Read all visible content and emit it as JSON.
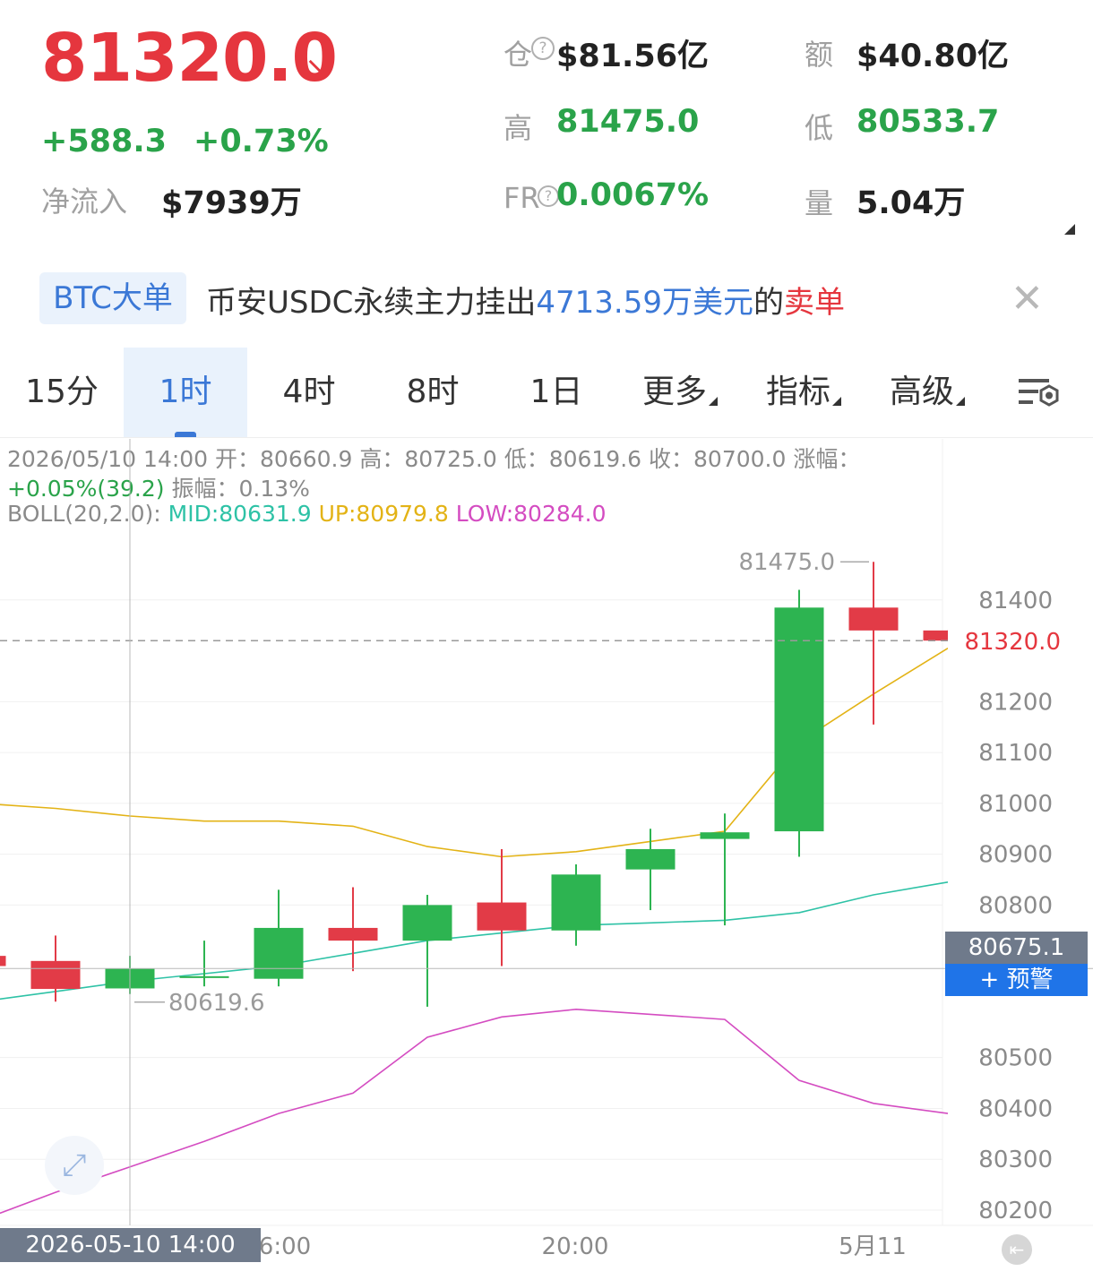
{
  "header": {
    "price": "81320.0",
    "arrow": "↘",
    "change": "+588.3",
    "change_pct": "+0.73%",
    "netflow_label": "净流入",
    "netflow_value": "$7939万",
    "open_interest_label": "仓",
    "open_interest_value": "$81.56亿",
    "volume_amount_label": "额",
    "volume_amount_value": "$40.80亿",
    "high_label": "高",
    "high_value": "81475.0",
    "low_label": "低",
    "low_value": "80533.7",
    "fr_label": "FR",
    "fr_value": "0.0067%",
    "vol_label": "量",
    "vol_value": "5.04万"
  },
  "banner": {
    "tag": "BTC大单",
    "text_prefix": "币安USDC永续主力挂出",
    "amount": "4713.59万美元",
    "text_mid": "的",
    "side": "卖单"
  },
  "tabs": [
    {
      "label": "15分"
    },
    {
      "label": "1时"
    },
    {
      "label": "4时"
    },
    {
      "label": "8时"
    },
    {
      "label": "1日"
    },
    {
      "label": "更多"
    },
    {
      "label": "指标"
    },
    {
      "label": "高级"
    }
  ],
  "info": {
    "line1": "2026/05/10 14:00 开：80660.9 高：80725.0 低：80619.6 收：80700.0 涨幅：",
    "change_text": "+0.05%(39.2)",
    "amplitude_text": "振幅：0.13%",
    "boll_label": "BOLL(20,2.0):",
    "mid_text": "MID:80631.9",
    "up_text": "UP:80979.8",
    "low_text": "LOW:80284.0"
  },
  "colors": {
    "up": "#2db451",
    "down": "#e23b47",
    "mid": "#2ec2a6",
    "upper": "#e3b316",
    "lower": "#d44cc1",
    "accent": "#1f74e8"
  },
  "chart_data": {
    "type": "candlestick",
    "x_labels": [
      "6:00",
      "20:00",
      "5月11"
    ],
    "y_ticks": [
      81400,
      81200,
      81100,
      81000,
      80900,
      80800,
      80500,
      80400,
      80300,
      80200
    ],
    "ylim": [
      80170,
      81530
    ],
    "high_marker": "81475.0",
    "low_marker": "80619.6",
    "current_price_label": "81320.0",
    "crosshair_price_label": "80675.1",
    "crosshair_date_label": "2026-05-10 14:00",
    "alert_button": "+ 预警",
    "candles": [
      {
        "open": 80700,
        "close": 80680,
        "high": 80700,
        "low": 80680
      },
      {
        "open": 80690,
        "close": 80635,
        "high": 80740,
        "low": 80610
      },
      {
        "open": 80636,
        "close": 80675,
        "high": 80700,
        "low": 80625
      },
      {
        "open": 80660,
        "close": 80660,
        "high": 80730,
        "low": 80640
      },
      {
        "open": 80655,
        "close": 80755,
        "high": 80830,
        "low": 80640
      },
      {
        "open": 80755,
        "close": 80730,
        "high": 80835,
        "low": 80670
      },
      {
        "open": 80730,
        "close": 80800,
        "high": 80820,
        "low": 80600
      },
      {
        "open": 80805,
        "close": 80750,
        "high": 80910,
        "low": 80680
      },
      {
        "open": 80750,
        "close": 80860,
        "high": 80880,
        "low": 80720
      },
      {
        "open": 80870,
        "close": 80910,
        "high": 80950,
        "low": 80790
      },
      {
        "open": 80930,
        "close": 80943,
        "high": 80980,
        "low": 80760
      },
      {
        "open": 80945,
        "close": 81385,
        "high": 81420,
        "low": 80895
      },
      {
        "open": 81385,
        "close": 81340,
        "high": 81475,
        "low": 81155
      },
      {
        "open": 81340,
        "close": 81320,
        "high": 81340,
        "low": 81320
      }
    ],
    "boll_mid": [
      80610,
      80630,
      80650,
      80665,
      80680,
      80705,
      80730,
      80745,
      80760,
      80765,
      80770,
      80785,
      80820,
      80845
    ],
    "boll_upper": [
      81000,
      80990,
      80975,
      80965,
      80965,
      80955,
      80915,
      80895,
      80905,
      80925,
      80945,
      81120,
      81215,
      81305
    ],
    "boll_lower": [
      80180,
      80235,
      80285,
      80335,
      80390,
      80430,
      80540,
      80580,
      80595,
      80585,
      80575,
      80455,
      80410,
      80390
    ]
  }
}
